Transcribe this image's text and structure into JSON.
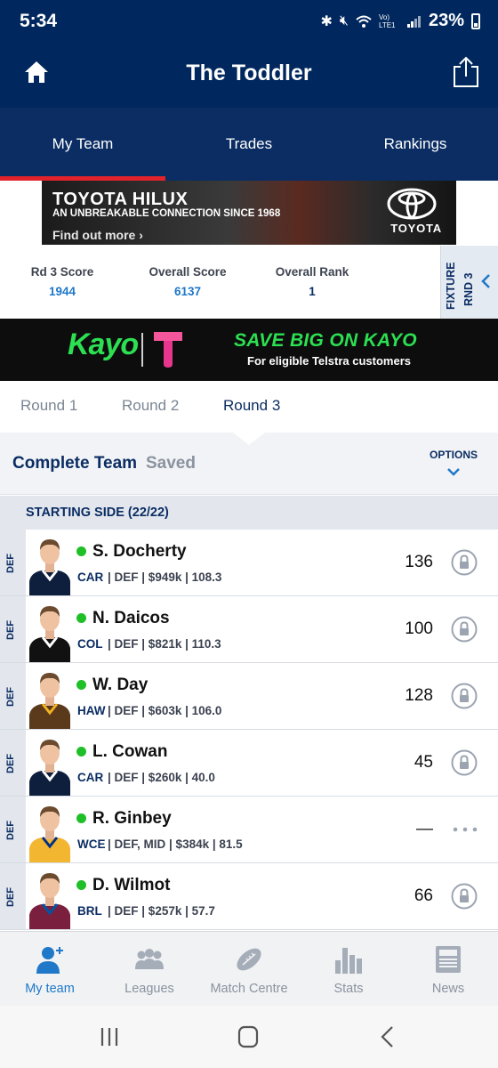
{
  "status_bar": {
    "time": "5:34",
    "network": "Vo) LTE1",
    "battery": "23%"
  },
  "header": {
    "title": "The Toddler"
  },
  "tabs": [
    {
      "label": "My Team",
      "active": true
    },
    {
      "label": "Trades",
      "active": false
    },
    {
      "label": "Rankings",
      "active": false
    }
  ],
  "ad_toyota": {
    "headline": "TOYOTA HILUX",
    "subline": "AN UNBREAKABLE CONNECTION SINCE 1968",
    "cta": "Find out more ›",
    "brand": "TOYOTA"
  },
  "scores": [
    {
      "label": "Rd 3 Score",
      "value": "1944"
    },
    {
      "label": "Overall Score",
      "value": "6137"
    },
    {
      "label": "Overall Rank",
      "value": "1"
    }
  ],
  "fixture_tab": {
    "label": "FIXTURE",
    "round": "RND 3"
  },
  "ad_kayo": {
    "brand": "Kayo",
    "headline": "SAVE BIG ON KAYO",
    "subline": "For eligible Telstra customers"
  },
  "round_tabs": [
    {
      "label": "Round 1",
      "active": false
    },
    {
      "label": "Round 2",
      "active": false
    },
    {
      "label": "Round 3",
      "active": true
    }
  ],
  "team_bar": {
    "title": "Complete Team",
    "status": "Saved",
    "options_label": "OPTIONS"
  },
  "section": {
    "title": "STARTING SIDE (22/22)"
  },
  "players": [
    {
      "position": "DEF",
      "name": "S. Docherty",
      "team": "CAR",
      "meta": "| DEF | $949k | 108.3",
      "score": "136",
      "action": "lock",
      "jersey": "#0e1e3d",
      "jersey_accent": "#ffffff"
    },
    {
      "position": "DEF",
      "name": "N. Daicos",
      "team": "COL",
      "meta": "| DEF | $821k | 110.3",
      "score": "100",
      "action": "lock",
      "jersey": "#111111",
      "jersey_accent": "#ffffff"
    },
    {
      "position": "DEF",
      "name": "W. Day",
      "team": "HAW",
      "meta": "| DEF | $603k | 106.0",
      "score": "128",
      "action": "lock",
      "jersey": "#5a3a1a",
      "jersey_accent": "#f0b323"
    },
    {
      "position": "DEF",
      "name": "L. Cowan",
      "team": "CAR",
      "meta": "| DEF | $260k | 40.0",
      "score": "45",
      "action": "lock",
      "jersey": "#0e1e3d",
      "jersey_accent": "#ffffff"
    },
    {
      "position": "DEF",
      "name": "R. Ginbey",
      "team": "WCE",
      "meta": "| DEF, MID | $384k | 81.5",
      "score": "—",
      "action": "more",
      "jersey": "#f2b630",
      "jersey_accent": "#003087"
    },
    {
      "position": "DEF",
      "name": "D. Wilmot",
      "team": "BRL",
      "meta": "| DEF | $257k | 57.7",
      "score": "66",
      "action": "lock",
      "jersey": "#7a1f3d",
      "jersey_accent": "#0055a4"
    }
  ],
  "bottom_nav": [
    {
      "label": "My team",
      "icon": "my-team-icon",
      "active": true
    },
    {
      "label": "Leagues",
      "icon": "leagues-icon",
      "active": false
    },
    {
      "label": "Match Centre",
      "icon": "football-icon",
      "active": false
    },
    {
      "label": "Stats",
      "icon": "stats-icon",
      "active": false
    },
    {
      "label": "News",
      "icon": "news-icon",
      "active": false
    }
  ],
  "colors": {
    "navy": "#01285e",
    "accent_red": "#e2232b",
    "link_blue": "#1f78c8",
    "status_green": "#1fbf28"
  }
}
